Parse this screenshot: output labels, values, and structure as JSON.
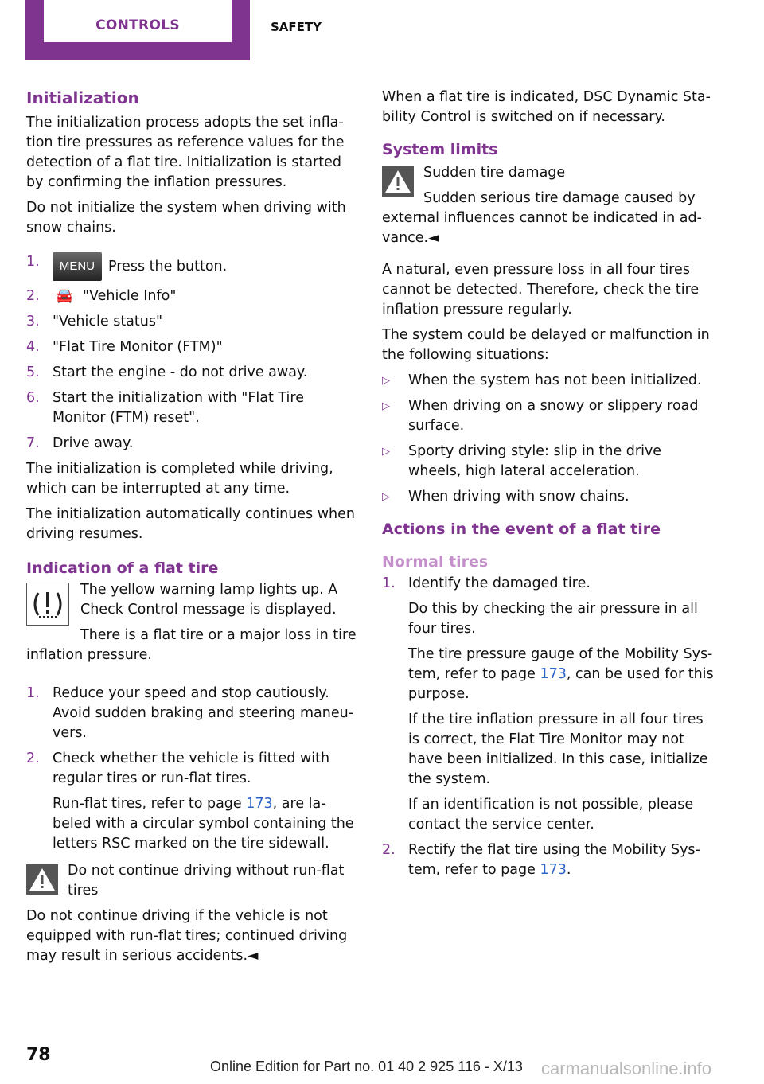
{
  "header": {
    "tab_active": "CONTROLS",
    "tab_inactive": "SAFETY"
  },
  "left": {
    "init_title": "Initialization",
    "init_p1": "The initialization process adopts the set infla-tion tire pressures as reference values for the detection of a flat tire. Initialization is started by confirming the inflation pressures.",
    "init_p2": "Do not initialize the system when driving with snow chains.",
    "steps": [
      {
        "n": "1.",
        "text": "Press the button."
      },
      {
        "n": "2.",
        "text": "\"Vehicle Info\""
      },
      {
        "n": "3.",
        "text": "\"Vehicle status\""
      },
      {
        "n": "4.",
        "text": "\"Flat Tire Monitor (FTM)\""
      },
      {
        "n": "5.",
        "text": "Start the engine - do not drive away."
      },
      {
        "n": "6.",
        "text": "Start the initialization with \"Flat Tire Monitor (FTM) reset\"."
      },
      {
        "n": "7.",
        "text": "Drive away."
      }
    ],
    "menu_label": "MENU",
    "init_p3": "The initialization is completed while driving, which can be interrupted at any time.",
    "init_p4": "The initialization automatically continues when driving resumes.",
    "ind_title": "Indication of a flat tire",
    "ind_p1": "The yellow warning lamp lights up. A Check Control message is displayed.",
    "ind_p2": "There is a flat tire or a major loss in tire inflation pressure.",
    "ind_steps": [
      {
        "n": "1.",
        "text": "Reduce your speed and stop cautiously. Avoid sudden braking and steering maneu-vers."
      },
      {
        "n": "2.",
        "text": "Check whether the vehicle is fitted with regular tires or run-flat tires.",
        "sub_pre": "Run-flat tires, refer to page ",
        "sub_link": "173",
        "sub_post": ", are la-beled with a circular symbol containing the letters RSC marked on the tire sidewall."
      }
    ],
    "warn_title": "Do not continue driving without run-flat tires",
    "warn_body": "Do not continue driving if the vehicle is not equipped with run-flat tires; continued driving may result in serious accidents.◄"
  },
  "right": {
    "p_dsc": "When a flat tire is indicated, DSC Dynamic Sta-bility Control is switched on if necessary.",
    "limits_title": "System limits",
    "warn_title": "Sudden tire damage",
    "warn_body": "Sudden serious tire damage caused by external influences cannot be indicated in ad-vance.◄",
    "p_loss": "A natural, even pressure loss in all four tires cannot be detected. Therefore, check the tire inflation pressure regularly.",
    "p_delay": "The system could be delayed or malfunction in the following situations:",
    "bullets": [
      "When the system has not been initialized.",
      "When driving on a snowy or slippery road surface.",
      "Sporty driving style: slip in the drive wheels, high lateral acceleration.",
      "When driving with snow chains."
    ],
    "actions_title": "Actions in the event of a flat tire",
    "normal_title": "Normal tires",
    "s1": "Identify the damaged tire.",
    "s1_a": "Do this by checking the air pressure in all four tires.",
    "s1_b_pre": "The tire pressure gauge of the Mobility Sys-tem, refer to page ",
    "s1_b_link": "173",
    "s1_b_post": ", can be used for this purpose.",
    "s1_c": "If the tire inflation pressure in all four tires is correct, the Flat Tire Monitor may not have been initialized. In this case, initialize the system.",
    "s1_d": "If an identification is not possible, please contact the service center.",
    "s2_pre": "Rectify the flat tire using the Mobility Sys-tem, refer to page ",
    "s2_link": "173",
    "s2_post": "."
  },
  "footer": {
    "page": "78",
    "edition": "Online Edition for Part no. 01 40 2 925 116 - X/13",
    "watermark": "carmanualsonline.info"
  }
}
